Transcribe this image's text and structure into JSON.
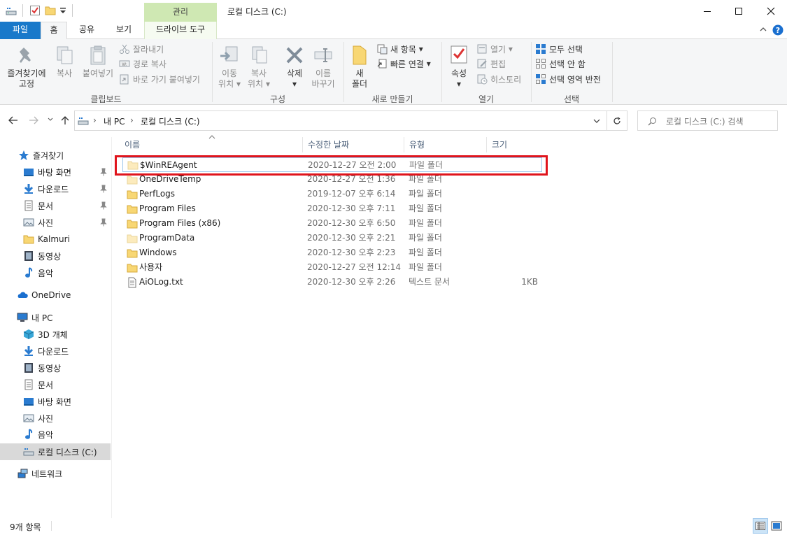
{
  "window": {
    "contextual_tab": "관리",
    "title": "로컬 디스크 (C:)"
  },
  "tabs": {
    "file": "파일",
    "home": "홈",
    "share": "공유",
    "view": "보기",
    "drive_tools": "드라이브 도구"
  },
  "ribbon": {
    "clipboard": {
      "pin_line1": "즐겨찾기에",
      "pin_line2": "고정",
      "copy": "복사",
      "paste": "붙여넣기",
      "cut": "잘라내기",
      "copy_path": "경로 복사",
      "paste_shortcut": "바로 가기 붙여넣기",
      "label": "클립보드"
    },
    "organize": {
      "move_line1": "이동",
      "move_line2": "위치",
      "copyto_line1": "복사",
      "copyto_line2": "위치",
      "delete": "삭제",
      "rename_line1": "이름",
      "rename_line2": "바꾸기",
      "label": "구성"
    },
    "new": {
      "folder_line1": "새",
      "folder_line2": "폴더",
      "new_item": "새 항목",
      "easy_access": "빠른 연결",
      "label": "새로 만들기"
    },
    "open": {
      "properties": "속성",
      "open": "열기",
      "edit": "편집",
      "history": "히스토리",
      "label": "열기"
    },
    "select": {
      "select_all": "모두 선택",
      "select_none": "선택 안 함",
      "invert": "선택 영역 반전",
      "label": "선택"
    }
  },
  "address": {
    "crumbs": [
      "내 PC",
      "로컬 디스크 (C:)"
    ],
    "search_placeholder": "로컬 디스크 (C:) 검색"
  },
  "nav": {
    "quick_access": "즐겨찾기",
    "quick_items": [
      "바탕 화면",
      "다운로드",
      "문서",
      "사진",
      "Kalmuri",
      "동영상",
      "음악"
    ],
    "onedrive": "OneDrive",
    "this_pc": "내 PC",
    "pc_items": [
      "3D 개체",
      "다운로드",
      "동영상",
      "문서",
      "바탕 화면",
      "사진",
      "음악",
      "로컬 디스크 (C:)"
    ],
    "network": "네트워크"
  },
  "columns": {
    "name": "이름",
    "modified": "수정한 날짜",
    "type": "유형",
    "size": "크기"
  },
  "files": [
    {
      "name": "$WinREAgent",
      "date": "2020-12-27 오전 2:00",
      "type": "파일 폴더",
      "size": "",
      "icon": "folder-hidden"
    },
    {
      "name": "OneDriveTemp",
      "date": "2020-12-27 오전 1:36",
      "type": "파일 폴더",
      "size": "",
      "icon": "folder-hidden"
    },
    {
      "name": "PerfLogs",
      "date": "2019-12-07 오후 6:14",
      "type": "파일 폴더",
      "size": "",
      "icon": "folder"
    },
    {
      "name": "Program Files",
      "date": "2020-12-30 오후 7:11",
      "type": "파일 폴더",
      "size": "",
      "icon": "folder"
    },
    {
      "name": "Program Files (x86)",
      "date": "2020-12-30 오후 6:50",
      "type": "파일 폴더",
      "size": "",
      "icon": "folder"
    },
    {
      "name": "ProgramData",
      "date": "2020-12-30 오후 2:21",
      "type": "파일 폴더",
      "size": "",
      "icon": "folder-hidden"
    },
    {
      "name": "Windows",
      "date": "2020-12-30 오후 2:23",
      "type": "파일 폴더",
      "size": "",
      "icon": "folder"
    },
    {
      "name": "사용자",
      "date": "2020-12-27 오전 12:14",
      "type": "파일 폴더",
      "size": "",
      "icon": "folder"
    },
    {
      "name": "AiOLog.txt",
      "date": "2020-12-30 오후 2:26",
      "type": "텍스트 문서",
      "size": "1KB",
      "icon": "text-file"
    }
  ],
  "status": {
    "count": "9개 항목"
  },
  "colors": {
    "file_tab": "#1979ca",
    "manage_tab": "#cfe8b3",
    "highlight": "#e0141c",
    "folder": "#f8d774"
  }
}
